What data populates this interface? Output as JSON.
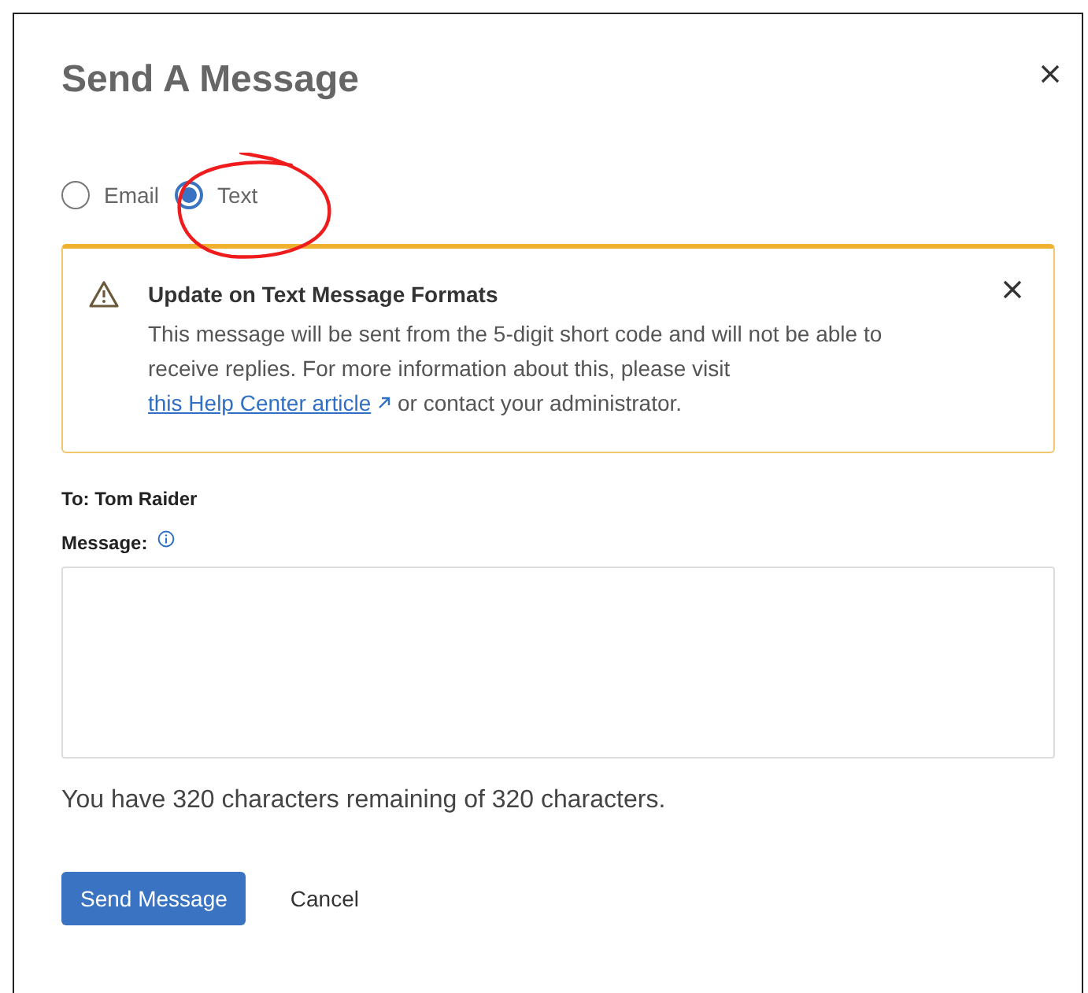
{
  "dialog": {
    "title": "Send A Message"
  },
  "channel_options": [
    {
      "label": "Email",
      "selected": false
    },
    {
      "label": "Text",
      "selected": true
    }
  ],
  "alert": {
    "title": "Update on Text Message Formats",
    "body": "This message will be sent from the 5-digit short code and will not be able to receive replies. For more information about this, please visit",
    "link": "this Help Center article",
    "body_after": "or contact your administrator."
  },
  "recipient": "To: Tom Raider",
  "message_label": "Message:",
  "counter": "You have 320 characters remaining of 320 characters.",
  "buttons": [
    {
      "kind": "primary",
      "label": "Send Message"
    },
    {
      "kind": "plain",
      "label": "Cancel"
    }
  ],
  "annotations": [
    {
      "kind": "circle"
    }
  ]
}
